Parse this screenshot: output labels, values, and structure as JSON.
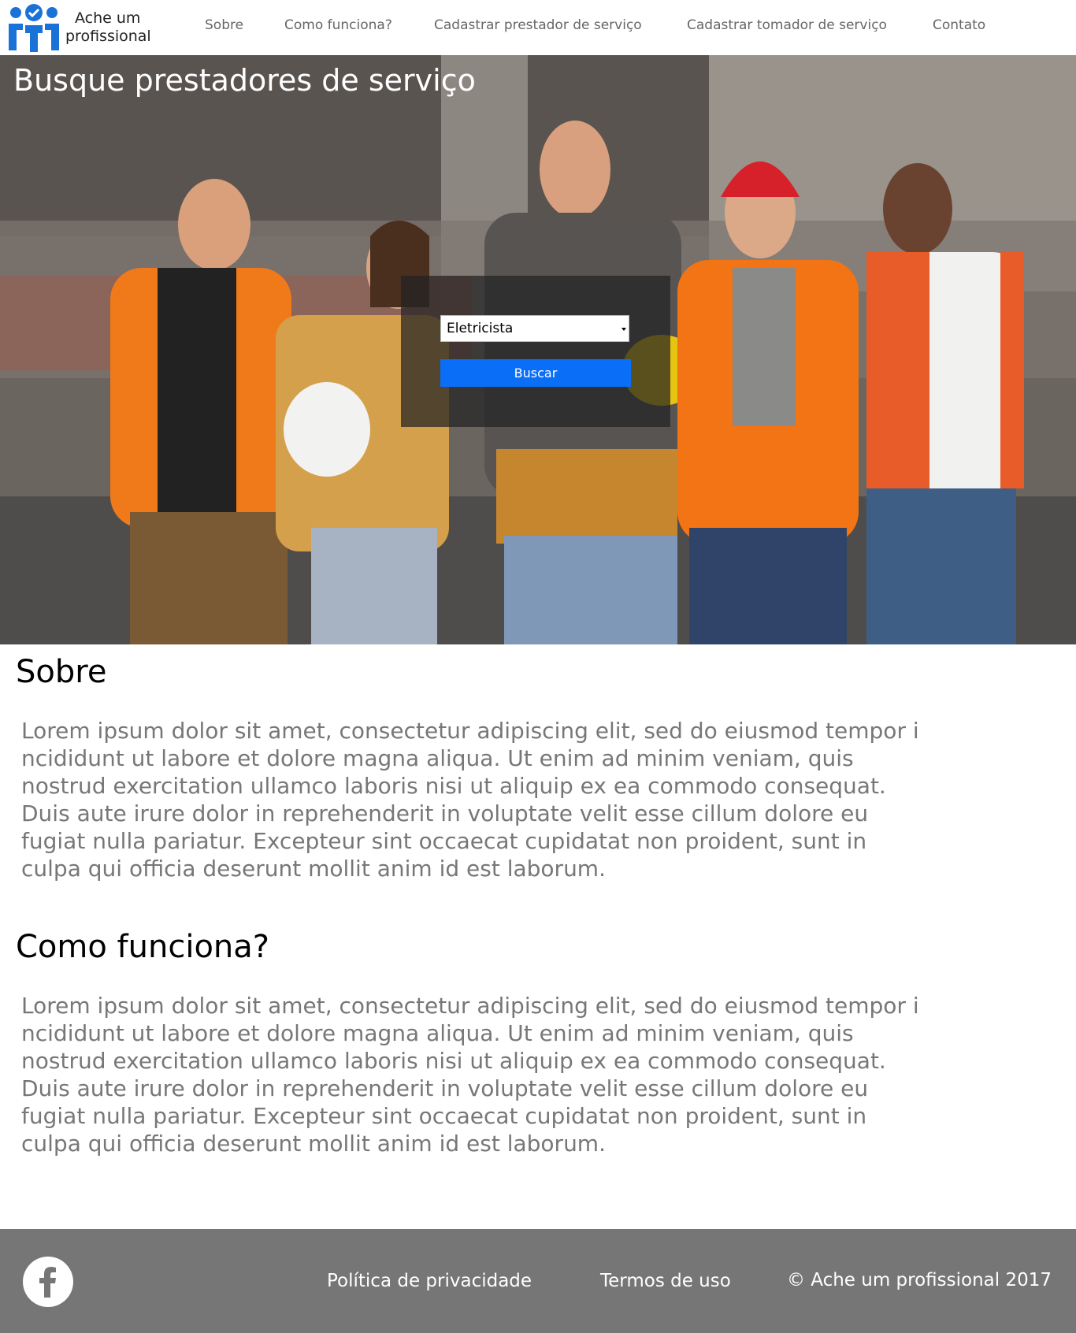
{
  "header": {
    "brand_line1": "Ache um",
    "brand_line2": "profissional",
    "nav": [
      "Sobre",
      "Como funciona?",
      "Cadastrar prestador de serviço",
      "Cadastrar tomador de serviço",
      "Contato"
    ]
  },
  "hero": {
    "title": "Busque prestadores de serviço",
    "select_value": "Eletricista",
    "button_label": "Buscar"
  },
  "sections": [
    {
      "title": "Sobre",
      "text": "Lorem ipsum dolor sit amet, consectetur adipiscing elit, sed do eiusmod tempor i\nncididunt ut labore et dolore magna aliqua. Ut enim ad minim veniam, quis\nnostrud exercitation ullamco laboris nisi ut aliquip ex ea commodo consequat.\nDuis aute irure dolor in reprehenderit in voluptate velit esse cillum dolore eu\nfugiat nulla pariatur. Excepteur sint occaecat  cupidatat non proident, sunt in\nculpa qui officia deserunt mollit  anim id est laborum."
    },
    {
      "title": "Como funciona?",
      "text": "Lorem ipsum dolor sit amet, consectetur adipiscing elit, sed do eiusmod tempor i\nncididunt ut labore et dolore magna aliqua. Ut enim ad minim veniam, quis\nnostrud exercitation ullamco laboris nisi ut aliquip ex ea commodo consequat.\nDuis aute irure dolor in reprehenderit in voluptate velit esse cillum dolore eu\nfugiat nulla pariatur. Excepteur sint occaecat  cupidatat non proident, sunt in\nculpa qui officia deserunt mollit  anim id est laborum."
    }
  ],
  "footer": {
    "privacy": "Política de privacidade",
    "terms": "Termos de uso",
    "copyright": "© Ache um profissional 2017"
  },
  "colors": {
    "accent": "#0a6ef7",
    "logo_blue": "#1a72d9",
    "footer_bg": "#767676"
  },
  "icons": {
    "logo": "people-check-logo-icon",
    "facebook": "facebook-icon"
  }
}
